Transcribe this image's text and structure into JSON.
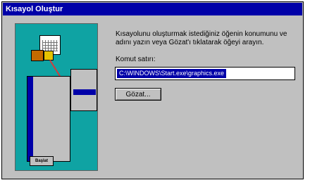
{
  "window": {
    "title": "Kısayol Oluştur"
  },
  "illustration": {
    "start_label": "Başlat"
  },
  "content": {
    "instruction": "Kısayolunu oluşturmak istediğiniz öğenin konumunu ve adını yazın veya Gözat'ı tıklatarak öğeyi arayın.",
    "command_line_label": "Komut satırı:",
    "command_line_value": "C:\\WINDOWS\\Start.exe\\graphics.exe",
    "browse_button": "Gözat..."
  }
}
